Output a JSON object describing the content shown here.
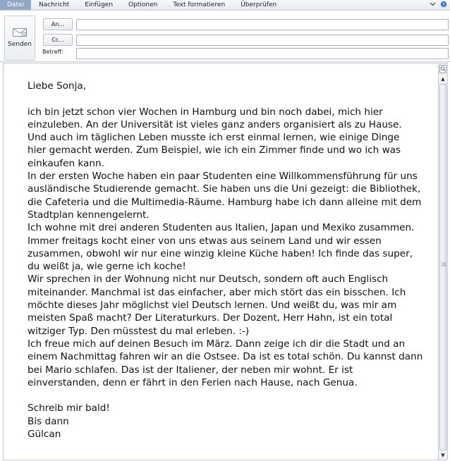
{
  "menu": {
    "tabs": [
      "Datei",
      "Nachricht",
      "Einfügen",
      "Optionen",
      "Text formatieren",
      "Überprüfen"
    ]
  },
  "header": {
    "send_label": "Senden",
    "to_label": "An...",
    "cc_label": "Cc...",
    "subject_label": "Betreff:",
    "to_value": "",
    "cc_value": "",
    "subject_value": ""
  },
  "letter": {
    "greeting": "Liebe Sonja,",
    "lines": [
      "ich bin jetzt schon vier Wochen in Hamburg und bin noch dabei, mich hier",
      "einzuleben. An der Universität ist vieles ganz anders organisiert als zu Hause.",
      "Und auch im täglichen Leben musste ich erst einmal lernen, wie einige Dinge",
      "hier gemacht werden. Zum Beispiel, wie ich ein Zimmer finde und wo ich was",
      "einkaufen kann.",
      "In der ersten Woche haben ein paar Studenten eine Willkommensführung für uns",
      "ausländische Studierende gemacht. Sie haben uns die Uni gezeigt: die Bibliothek,",
      "die Cafeteria und die Multimedia-Räume. Hamburg habe ich dann alleine mit dem",
      "Stadtplan kennengelernt.",
      "Ich wohne mit drei anderen Studenten aus Italien, Japan und Mexiko zusammen.",
      "Immer freitags kocht einer von uns etwas aus seinem Land und wir essen",
      "zusammen, obwohl wir nur eine winzig kleine Küche haben! Ich finde das super,",
      "du weißt ja, wie gerne ich koche!",
      "Wir sprechen in der Wohnung nicht nur Deutsch, sondern oft auch Englisch",
      "miteinander. Manchmal ist das einfacher, aber mich stört das ein bisschen. Ich",
      "möchte dieses Jahr möglichst viel Deutsch lernen. Und weißt du, was mir am",
      "meisten Spaß macht? Der Literaturkurs. Der Dozent, Herr Hahn, ist ein total",
      "witziger Typ. Den müsstest du mal erleben. :-)",
      "Ich freue mich auf deinen Besuch im März. Dann zeige ich dir die Stadt und an",
      "einem Nachmittag fahren wir an die Ostsee. Da ist es total schön. Du kannst dann",
      "bei Mario schlafen. Das ist der Italiener, der neben mir wohnt. Er ist",
      "einverstanden, denn er fährt in den Ferien nach Hause, nach Genua."
    ],
    "closing": [
      "Schreib mir bald!",
      "Bis dann",
      "Gülcan"
    ]
  },
  "icons": {
    "help": "help-icon",
    "minimize_ribbon": "chevron-down-icon",
    "zoom": "zoom-icon",
    "scroll_up": "scroll-up-arrow-icon",
    "scroll_down": "scroll-down-arrow-icon"
  },
  "colors": {
    "active_tab": "#8fa8c8"
  }
}
